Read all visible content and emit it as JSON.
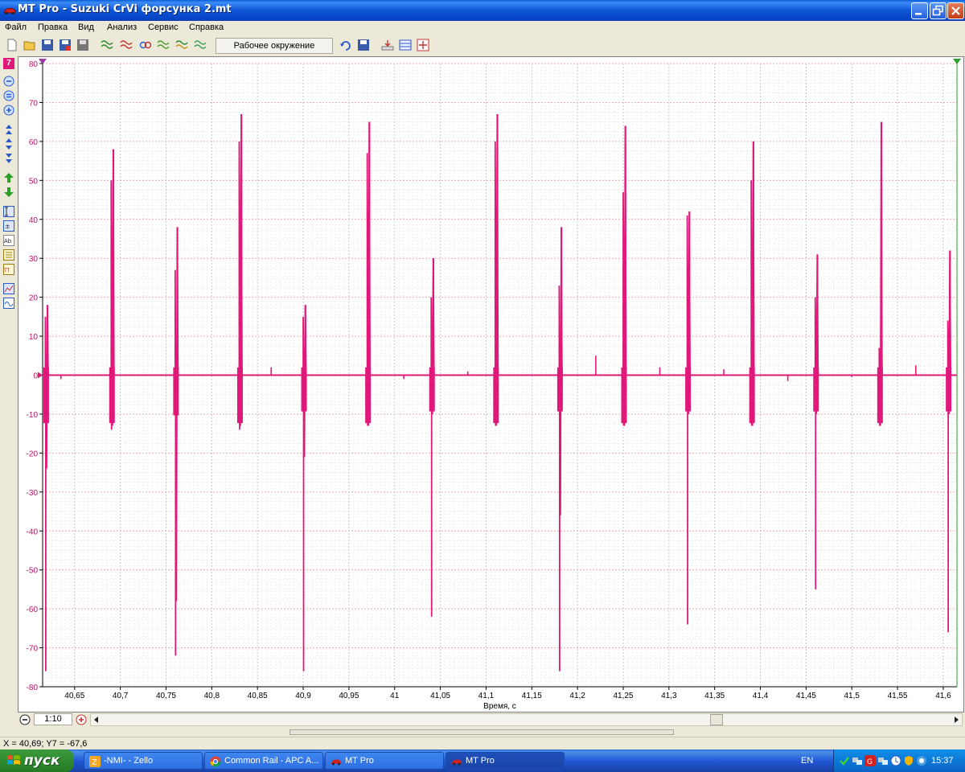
{
  "window": {
    "title": "MT Pro - Suzuki CrVi форсунка 2.mt",
    "app_icon": "mt-pro-car-icon"
  },
  "menu": [
    "Файл",
    "Правка",
    "Вид",
    "Анализ",
    "Сервис",
    "Справка"
  ],
  "toolbar": {
    "workspace_label": "Рабочее окружение"
  },
  "left_toolbar": {
    "channel_badge": "7"
  },
  "chart_data": {
    "type": "line",
    "xlabel": "Время, с",
    "ylabel": "",
    "xlim": [
      40.615,
      41.615
    ],
    "ylim": [
      -80,
      80
    ],
    "y_ticks": [
      80,
      70,
      60,
      50,
      40,
      30,
      20,
      10,
      0,
      -10,
      -20,
      -30,
      -40,
      -50,
      -60,
      -70,
      -80
    ],
    "x_ticks": [
      "40,65",
      "40,7",
      "40,75",
      "40,8",
      "40,85",
      "40,9",
      "40,95",
      "41",
      "41,05",
      "41,1",
      "41,15",
      "41,2",
      "41,25",
      "41,3",
      "41,35",
      "41,4",
      "41,45",
      "41,5",
      "41,55",
      "41,6"
    ],
    "x_tick_values": [
      40.65,
      40.7,
      40.75,
      40.8,
      40.85,
      40.9,
      40.95,
      41.0,
      41.05,
      41.1,
      41.15,
      41.2,
      41.25,
      41.3,
      41.35,
      41.4,
      41.45,
      41.5,
      41.55,
      41.6
    ],
    "grid": true,
    "line_color": "#e0187a",
    "series": [
      {
        "events": [
          {
            "t": 40.618,
            "hi": 18,
            "lo": -76,
            "hi2": 15,
            "lo2": -24,
            "ripple": -12
          },
          {
            "t": 40.69,
            "hi": 58,
            "lo": -14,
            "hi2": 50,
            "lo2": -13,
            "ripple": -12
          },
          {
            "t": 40.76,
            "hi": 38,
            "lo": -72,
            "hi2": 27,
            "lo2": -58,
            "ripple": -10
          },
          {
            "t": 40.83,
            "hi": 67,
            "lo": -14,
            "hi2": 60,
            "lo2": -13,
            "ripple": -12
          },
          {
            "t": 40.9,
            "hi": 18,
            "lo": -76,
            "hi2": 15,
            "lo2": -21,
            "ripple": -9
          },
          {
            "t": 40.97,
            "hi": 65,
            "lo": -13,
            "hi2": 57,
            "lo2": -13,
            "ripple": -12
          },
          {
            "t": 41.04,
            "hi": 30,
            "lo": -62,
            "hi2": 20,
            "lo2": -10,
            "ripple": -9
          },
          {
            "t": 41.11,
            "hi": 67,
            "lo": -13,
            "hi2": 60,
            "lo2": -13,
            "ripple": -12
          },
          {
            "t": 41.18,
            "hi": 38,
            "lo": -76,
            "hi2": 23,
            "lo2": -36,
            "ripple": -9
          },
          {
            "t": 41.25,
            "hi": 64,
            "lo": -13,
            "hi2": 47,
            "lo2": -13,
            "ripple": -12
          },
          {
            "t": 41.32,
            "hi": 42,
            "lo": -64,
            "hi2": 41,
            "lo2": -10,
            "ripple": -9
          },
          {
            "t": 41.39,
            "hi": 60,
            "lo": -13,
            "hi2": 50,
            "lo2": -13,
            "ripple": -12
          },
          {
            "t": 41.46,
            "hi": 31,
            "lo": -55,
            "hi2": 20,
            "lo2": -10,
            "ripple": -9
          },
          {
            "t": 41.53,
            "hi": 65,
            "lo": -13,
            "hi2": 7,
            "lo2": -13,
            "ripple": -12
          },
          {
            "t": 41.605,
            "hi": 32,
            "lo": -66,
            "hi2": 14,
            "lo2": -10,
            "ripple": -9
          }
        ],
        "blips": [
          {
            "t": 40.635,
            "v": -1
          },
          {
            "t": 40.865,
            "v": 2
          },
          {
            "t": 41.01,
            "v": -1
          },
          {
            "t": 41.08,
            "v": 1
          },
          {
            "t": 41.22,
            "v": 5
          },
          {
            "t": 41.29,
            "v": 2
          },
          {
            "t": 41.36,
            "v": 1.5
          },
          {
            "t": 41.43,
            "v": -1.5
          },
          {
            "t": 41.5,
            "v": -0.5
          },
          {
            "t": 41.57,
            "v": 2.5
          }
        ]
      }
    ]
  },
  "bottom": {
    "zoom_label": "1:10"
  },
  "status": {
    "text": "X = 40,69; Y7 = -67,6"
  },
  "taskbar": {
    "start_label": "пуск",
    "tasks": [
      {
        "label": "-NMI- - Zello",
        "icon": "zello-icon",
        "active": false
      },
      {
        "label": "Common Rail - APC A...",
        "icon": "chrome-icon",
        "active": false
      },
      {
        "label": "MT Pro",
        "icon": "mt-pro-icon",
        "active": false
      },
      {
        "label": "MT Pro",
        "icon": "mt-pro-icon",
        "active": true
      }
    ],
    "language": "EN",
    "clock": "15:37"
  }
}
